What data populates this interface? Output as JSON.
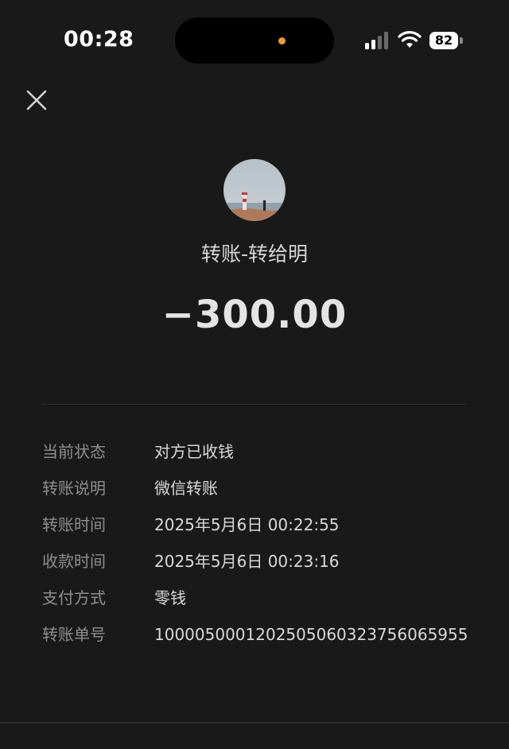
{
  "status_bar": {
    "time": "00:28",
    "battery_level": "82",
    "icons": [
      "signal-icon",
      "wifi-icon",
      "battery-icon"
    ]
  },
  "header": {
    "close_icon": "close-icon"
  },
  "transfer": {
    "title": "转账-转给明",
    "amount": "−300.00"
  },
  "details": [
    {
      "label": "当前状态",
      "value": "对方已收钱"
    },
    {
      "label": "转账说明",
      "value": "微信转账"
    },
    {
      "label": "转账时间",
      "value": "2025年5月6日 00:22:55"
    },
    {
      "label": "收款时间",
      "value": "2025年5月6日 00:23:16"
    },
    {
      "label": "支付方式",
      "value": "零钱"
    },
    {
      "label": "转账单号",
      "value": "100005000120250506032375606595​5"
    }
  ],
  "colors": {
    "background": "#191919",
    "label": "#8e8e8e",
    "value": "#d9d9d9",
    "island_dot": "#f29a2c"
  }
}
